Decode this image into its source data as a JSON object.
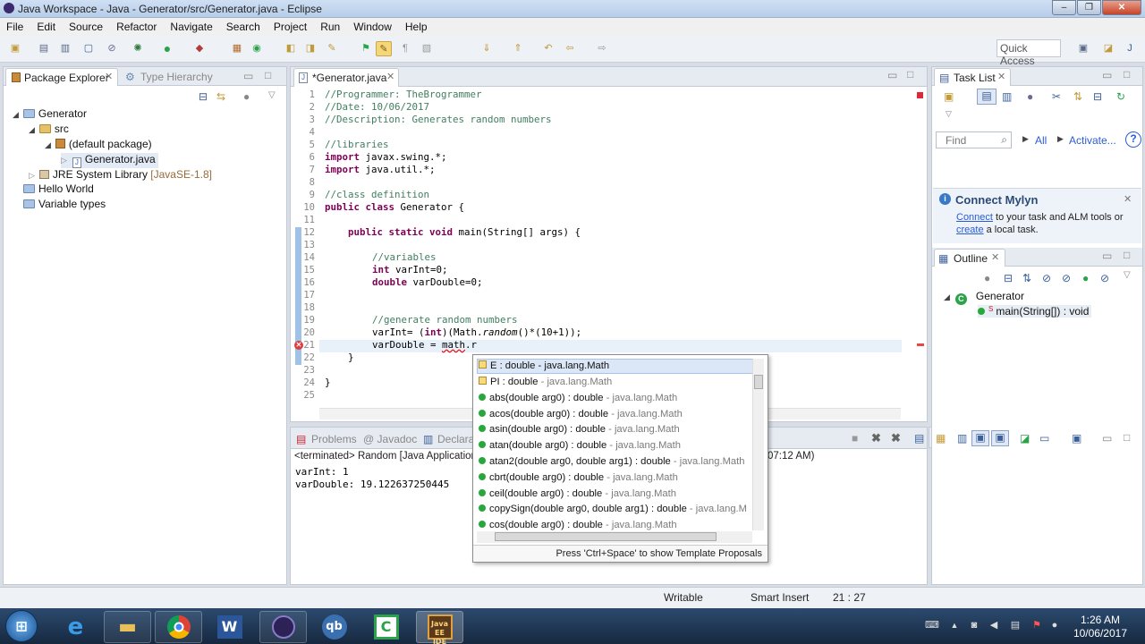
{
  "window": {
    "title": "Java Workspace - Java - Generator/src/Generator.java - Eclipse",
    "controls": [
      "–",
      "❐",
      "✕"
    ]
  },
  "menu": [
    "File",
    "Edit",
    "Source",
    "Refactor",
    "Navigate",
    "Search",
    "Project",
    "Run",
    "Window",
    "Help"
  ],
  "toolbar": {
    "quick_access": "Quick Access"
  },
  "package_explorer": {
    "tabs": [
      "Package Explorer",
      "Type Hierarchy"
    ],
    "tree": [
      {
        "label": "Generator"
      },
      {
        "label": "src"
      },
      {
        "label": "(default package)"
      },
      {
        "label": "Generator.java"
      },
      {
        "label": "JRE System Library",
        "suffix": "[JavaSE-1.8]"
      },
      {
        "label": "Hello World"
      },
      {
        "label": "Variable types"
      }
    ]
  },
  "editor": {
    "tab": "*Generator.java",
    "line_numbers": [
      "1",
      "2",
      "3",
      "4",
      "5",
      "6",
      "7",
      "8",
      "9",
      "10",
      "11",
      "12",
      "13",
      "14",
      "15",
      "16",
      "17",
      "18",
      "19",
      "20",
      "21",
      "22",
      "23",
      "24",
      "25"
    ],
    "code": {
      "l1": "//Programmer: TheBrogrammer",
      "l2": "//Date: 10/06/2017",
      "l3": "//Description: Generates random numbers",
      "l5": "//libraries",
      "l6_kw": "import",
      "l6": " javax.swing.*;",
      "l7_kw": "import",
      "l7": " java.util.*;",
      "l9": "//class definition",
      "l10_kw1": "public",
      "l10_kw2": "class",
      "l10": " Generator {",
      "l12_kw": "public static void",
      "l12": " main(String[] args) {",
      "l14": "//variables",
      "l15_kw": "int",
      "l15": " varInt=0;",
      "l16_kw": "double",
      "l16": " varDouble=0;",
      "l19": "//generate random numbers",
      "l20a": "varInt= (",
      "l20_kw": "int",
      "l20b": ")(Math.",
      "l20_it": "random",
      "l20c": "()*(10+1));",
      "l21a": "varDouble = ",
      "l21_err": "math",
      "l21b": ".r",
      "l22": "}",
      "l24": "}"
    }
  },
  "content_assist": {
    "items": [
      {
        "name": "E : double",
        "owner": " - java.lang.Math",
        "kind": "field"
      },
      {
        "name": "PI : double",
        "owner": " - java.lang.Math",
        "kind": "field"
      },
      {
        "name": "abs(double arg0) : double",
        "owner": " - java.lang.Math",
        "kind": "method"
      },
      {
        "name": "acos(double arg0) : double",
        "owner": " - java.lang.Math",
        "kind": "method"
      },
      {
        "name": "asin(double arg0) : double",
        "owner": " - java.lang.Math",
        "kind": "method"
      },
      {
        "name": "atan(double arg0) : double",
        "owner": " - java.lang.Math",
        "kind": "method"
      },
      {
        "name": "atan2(double arg0, double arg1) : double",
        "owner": " - java.lang.Math",
        "kind": "method"
      },
      {
        "name": "cbrt(double arg0) : double",
        "owner": " - java.lang.Math",
        "kind": "method"
      },
      {
        "name": "ceil(double arg0) : double",
        "owner": " - java.lang.Math",
        "kind": "method"
      },
      {
        "name": "copySign(double arg0, double arg1) : double",
        "owner": " - java.lang.M",
        "kind": "method"
      },
      {
        "name": "cos(double arg0) : double",
        "owner": " - java.lang.Math",
        "kind": "method"
      }
    ],
    "footer": "Press 'Ctrl+Space' to show Template Proposals"
  },
  "task_list": {
    "tab": "Task List",
    "find_placeholder": "Find",
    "all": "All",
    "activate": "Activate...",
    "help": "?"
  },
  "mylyn": {
    "title": "Connect Mylyn",
    "link1": "Connect",
    "text1": " to your task and ALM tools or",
    "link2": "create",
    "text2": " a local task."
  },
  "outline": {
    "tab": "Outline",
    "class": "Generator",
    "method": "main(String[]) : void"
  },
  "console": {
    "tabs": [
      "Problems",
      "@ Javadoc",
      "Declara"
    ],
    "header": "<terminated> Random [Java Application",
    "header_tail": "07:12 AM)",
    "lines": [
      "varInt: 1",
      "varDouble: 19.122637250445"
    ]
  },
  "status": {
    "writable": "Writable",
    "mode": "Smart Insert",
    "position": "21 : 27"
  },
  "taskbar": {
    "time": "1:26 AM",
    "date": "10/06/2017"
  }
}
